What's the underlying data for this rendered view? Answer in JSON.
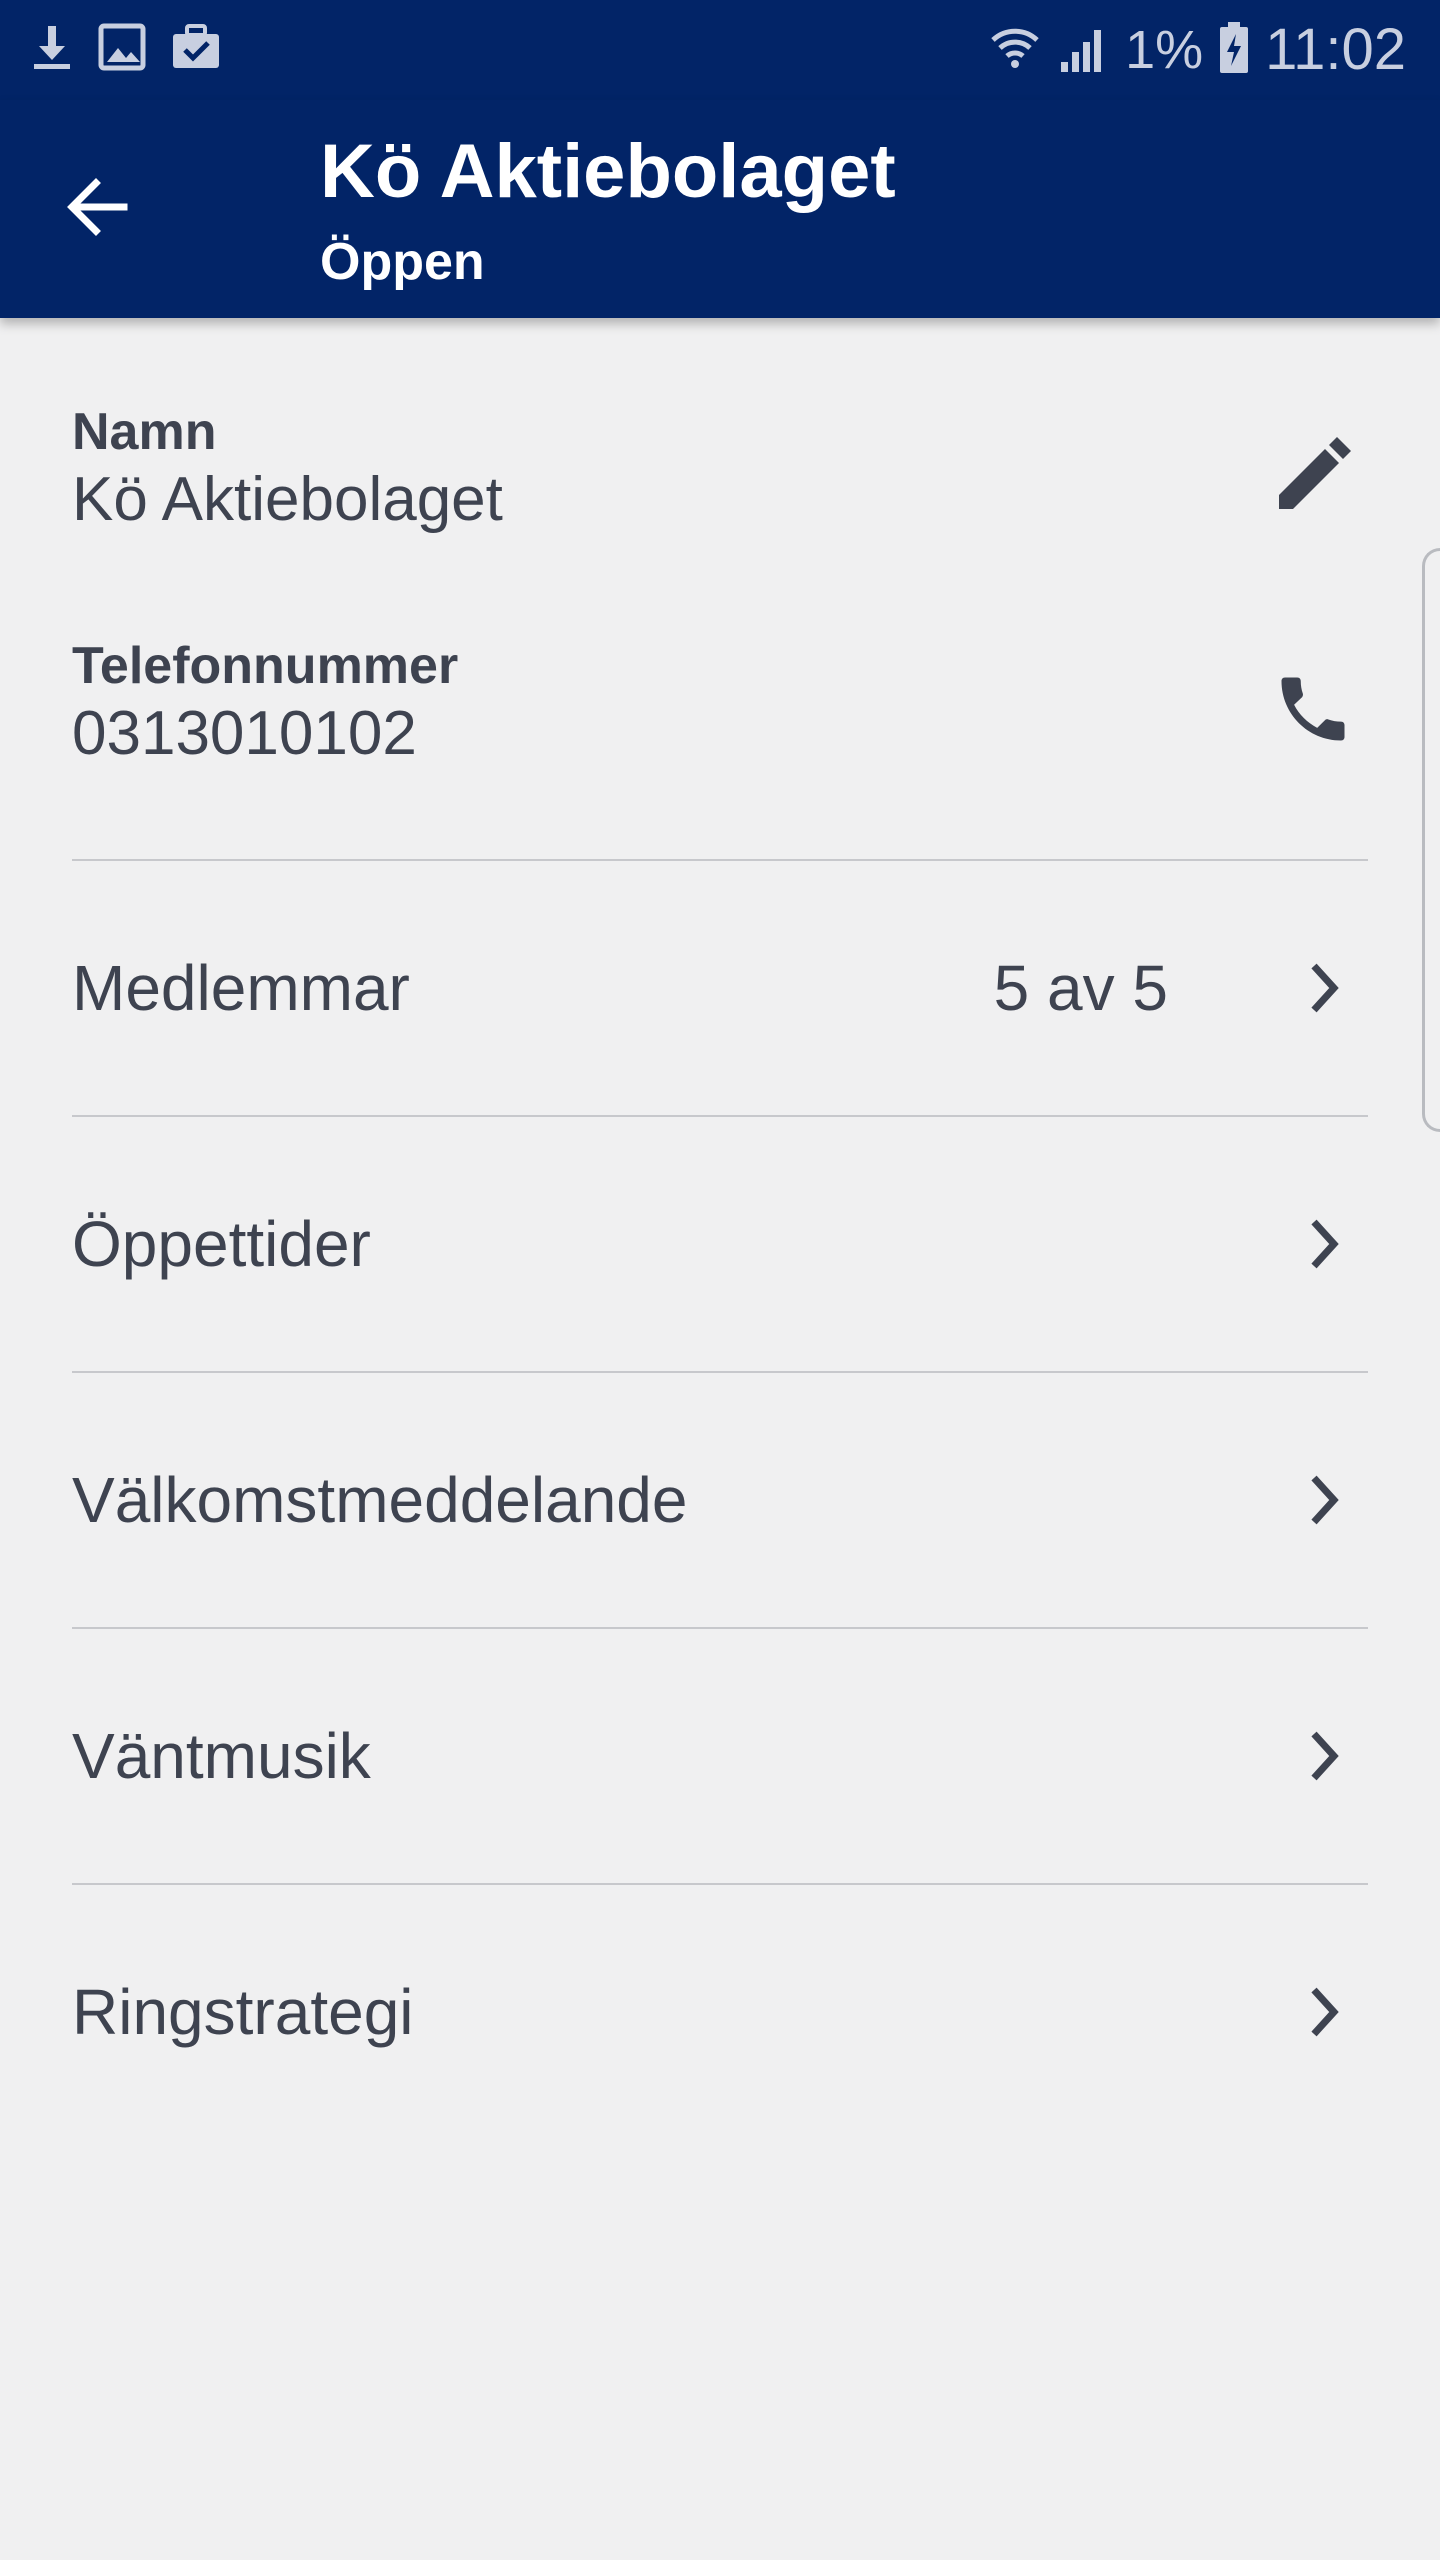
{
  "status_bar": {
    "icons_left": [
      "download-icon",
      "image-icon",
      "briefcase-check-icon"
    ],
    "icons_right": [
      "wifi-icon",
      "signal-icon"
    ],
    "battery_percent": "1%",
    "battery_icon": "battery-charging-icon",
    "time": "11:02"
  },
  "app_bar": {
    "back_icon": "arrow-back-icon",
    "title": "Kö Aktiebolaget",
    "subtitle": "Öppen",
    "background_color": "#022467"
  },
  "info": {
    "name": {
      "label": "Namn",
      "value": "Kö Aktiebolaget",
      "action_icon": "edit-pencil-icon"
    },
    "phone": {
      "label": "Telefonnummer",
      "value": "0313010102",
      "action_icon": "phone-icon"
    }
  },
  "menu": {
    "members": {
      "label": "Medlemmar",
      "value": "5 av 5"
    },
    "opening_hours": {
      "label": "Öppettider"
    },
    "welcome_message": {
      "label": "Välkomstmeddelande"
    },
    "hold_music": {
      "label": "Väntmusik"
    },
    "ring_strategy": {
      "label": "Ringstrategi"
    }
  }
}
